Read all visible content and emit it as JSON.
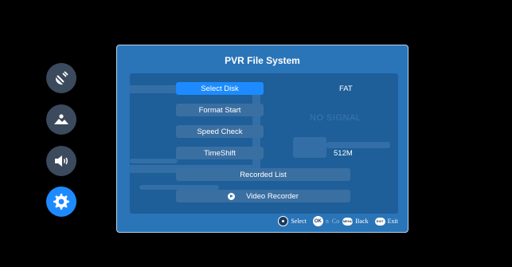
{
  "sidebar": {
    "items": [
      {
        "name": "satellite-icon",
        "active": false
      },
      {
        "name": "picture-icon",
        "active": false
      },
      {
        "name": "volume-icon",
        "active": false
      },
      {
        "name": "gear-icon",
        "active": true
      }
    ]
  },
  "dialog": {
    "title": "PVR File System",
    "background_watermark": "NO SIGNAL",
    "rows": [
      {
        "label": "Select Disk",
        "value": "FAT",
        "selected": true
      },
      {
        "label": "Format Start",
        "value": ""
      },
      {
        "label": "Speed Check",
        "value": ""
      },
      {
        "label": "TimeShift",
        "value": "512M"
      },
      {
        "label": "Recorded List",
        "value": ""
      },
      {
        "label": "Video Recorder",
        "value": "",
        "icon": "play-icon"
      }
    ]
  },
  "hints": {
    "select_label": "Select",
    "ok_key": "OK",
    "partial_1": "n",
    "partial_2": "Co",
    "menu_key": "MENU",
    "back_label": "Back",
    "exit_key": "EXIT",
    "exit_label": "Exit"
  },
  "colors": {
    "accent": "#1d8bff",
    "dialog_bg": "#2a74b8",
    "panel_bg": "#1e5e99",
    "button_bg": "#3a6fa2"
  }
}
